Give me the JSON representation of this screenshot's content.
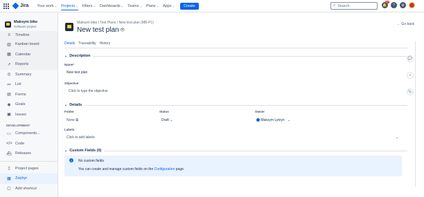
{
  "topbar": {
    "app_name": "Jira",
    "nav": [
      "Your work",
      "Projects",
      "Filters",
      "Dashboards",
      "Teams",
      "Plans",
      "Apps"
    ],
    "active_nav": "Projects",
    "create_label": "Create",
    "search_placeholder": "Search",
    "notifications_badge": "9+"
  },
  "sidebar": {
    "project_name": "Maksym bike",
    "project_type": "Software project",
    "planning_items": [
      {
        "label": "Timeline",
        "icon": "timeline-icon"
      },
      {
        "label": "Kanban board",
        "icon": "board-icon"
      },
      {
        "label": "Calendar",
        "icon": "calendar-icon"
      },
      {
        "label": "Reports",
        "icon": "reports-icon"
      }
    ],
    "items": [
      {
        "label": "Summary",
        "icon": "summary-icon"
      },
      {
        "label": "List",
        "icon": "list-icon"
      },
      {
        "label": "Forms",
        "icon": "forms-icon"
      },
      {
        "label": "Goals",
        "icon": "goals-icon"
      },
      {
        "label": "Issues",
        "icon": "issues-icon"
      }
    ],
    "dev_section_title": "DEVELOPMENT",
    "dev_items": [
      {
        "label": "Components...",
        "icon": "components-icon"
      },
      {
        "label": "Code",
        "icon": "code-icon"
      },
      {
        "label": "Releases",
        "icon": "releases-icon"
      }
    ],
    "bottom_items": [
      {
        "label": "Project pages",
        "icon": "pages-icon",
        "active": false
      },
      {
        "label": "Zephyr",
        "icon": "zephyr-icon",
        "active": true
      },
      {
        "label": "Add shortcut",
        "icon": "shortcut-icon",
        "active": false
      }
    ]
  },
  "page": {
    "breadcrumbs": [
      "Maksym bike",
      "Test Plans",
      "New test plan (MB-P1)"
    ],
    "title": "New test plan",
    "go_back_label": "Go back",
    "tabs": [
      "Details",
      "Traceability",
      "History"
    ],
    "active_tab": "Details"
  },
  "description": {
    "header": "Description",
    "name_label": "Name",
    "name_required": "*",
    "name_value": "New test plan",
    "objective_label": "Objective",
    "objective_placeholder": "Click to type the objective"
  },
  "details": {
    "header": "Details",
    "folder_label": "Folder",
    "folder_value": "None",
    "status_label": "Status",
    "status_value": "Draft",
    "owner_label": "Owner",
    "owner_value": "Maksym Lytvyn",
    "labels_label": "Labels",
    "labels_placeholder": "Click to add labels"
  },
  "custom_fields": {
    "header": "Custom Fields (0)",
    "info_title": "No custom fields",
    "info_text_before": "You can create and manage custom fields on the",
    "info_link": "Configuration",
    "info_text_after": "page."
  },
  "colors": {
    "accent": "#0c66e4",
    "sidebar_bg": "#f7f8f9",
    "info_bg": "#e9f2ff",
    "notification_badge": "#ca3521"
  }
}
